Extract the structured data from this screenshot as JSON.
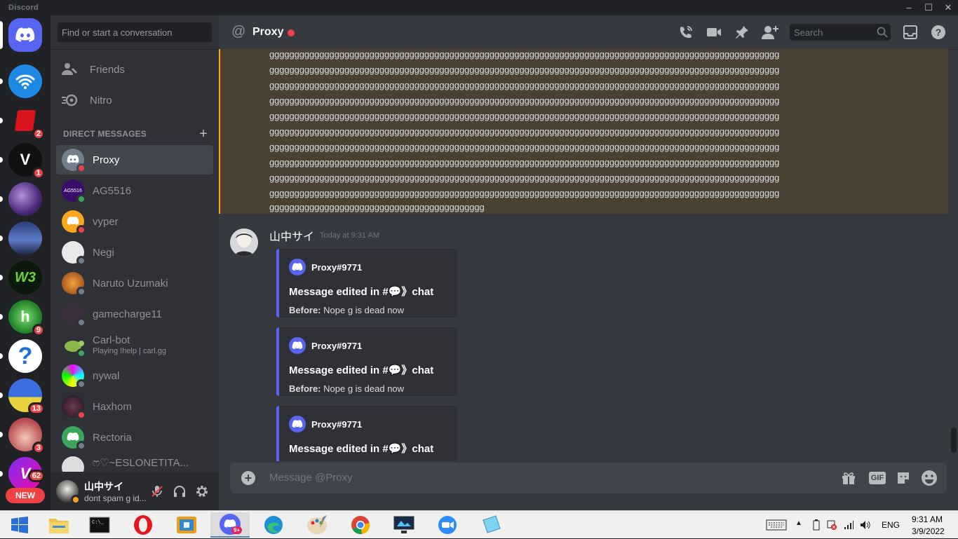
{
  "app": {
    "brand": "Discord"
  },
  "guilds": [
    {
      "name": "home",
      "badge": ""
    },
    {
      "name": "wifi-server",
      "badge": ""
    },
    {
      "name": "red-logo-server",
      "badge": "2"
    },
    {
      "name": "v-server",
      "letter": "V",
      "badge": "1"
    },
    {
      "name": "galaxy-server",
      "badge": ""
    },
    {
      "name": "night-town-server",
      "badge": ""
    },
    {
      "name": "w3-server",
      "badge": ""
    },
    {
      "name": "green-h-server",
      "badge": "9"
    },
    {
      "name": "question-server",
      "badge": ""
    },
    {
      "name": "blue-banner-server",
      "badge": "13"
    },
    {
      "name": "anime-girl-server",
      "badge": "3"
    },
    {
      "name": "v-purple-server",
      "badge": "62"
    }
  ],
  "guild_new_label": "NEW",
  "sidebar": {
    "search_placeholder": "Find or start a conversation",
    "friends_label": "Friends",
    "nitro_label": "Nitro",
    "dm_header": "DIRECT MESSAGES",
    "dms": [
      {
        "name": "Proxy",
        "status": "dnd",
        "selected": true
      },
      {
        "name": "AG5516",
        "status": "on"
      },
      {
        "name": "vyper",
        "status": "dnd"
      },
      {
        "name": "Negi",
        "status": "off"
      },
      {
        "name": "Naruto Uzumaki",
        "status": "off"
      },
      {
        "name": "gamecharge11",
        "status": "off"
      },
      {
        "name": "Carl-bot",
        "sub": "Playing !help | carl.gg",
        "status": "on"
      },
      {
        "name": "nywal",
        "status": "off"
      },
      {
        "name": "Haxhom",
        "status": "dnd"
      },
      {
        "name": "Rectoria",
        "status": "off"
      },
      {
        "name": "ෆ♡~ESLONETITA...",
        "status": "off"
      }
    ],
    "avatar_ag_text": "AG5516"
  },
  "user": {
    "name": "山中サイ",
    "status": "dont spam g id..."
  },
  "channel": {
    "at": "@",
    "name": "Proxy",
    "search_placeholder": "Search"
  },
  "spam_lines": [
    "gggggggggggggggggggggggggggggggggggggggggggggggggggggggggggggggggggggggggggggggggggggggggggggggggggggg",
    "gggggggggggggggggggggggggggggggggggggggggggggggggggggggggggggggggggggggggggggggggggggggggggggggggggggg",
    "gggggggggggggggggggggggggggggggggggggggggggggggggggggggggggggggggggggggggggggggggggggggggggggggggggggg",
    "gggggggggggggggggggggggggggggggggggggggggggggggggggggggggggggggggggggggggggggggggggggggggggggggggggggg",
    "gggggggggggggggggggggggggggggggggggggggggggggggggggggggggggggggggggggggggggggggggggggggggggggggggggggg",
    "gggggggggggggggggggggggggggggggggggggggggggggggggggggggggggggggggggggggggggggggggggggggggggggggggggggg",
    "gggggggggggggggggggggggggggggggggggggggggggggggggggggggggggggggggggggggggggggggggggggggggggggggggggggg",
    "gggggggggggggggggggggggggggggggggggggggggggggggggggggggggggggggggggggggggggggggggggggggggggggggggggggg",
    "gggggggggggggggggggggggggggggggggggggggggggggggggggggggggggggggggggggggggggggggggggggggggggggggggggggg",
    "gggggggggggggggggggggggggggggggggggggggggggggggggggggggggggggggggggggggggggggggggggggggggggggggggggggg",
    "ggggggggggggggggggggggggggggggggggggggggggg"
  ],
  "message": {
    "author": "山中サイ",
    "timestamp": "Today at 9:31 AM",
    "embeds": [
      {
        "author": "Proxy#9771",
        "title": "Message edited in #💬》chat",
        "before_label": "Before:",
        "before_text": "Nope g is dead now"
      },
      {
        "author": "Proxy#9771",
        "title": "Message edited in #💬》chat",
        "before_label": "Before:",
        "before_text": "Nope g is dead now"
      },
      {
        "author": "Proxy#9771",
        "title": "Message edited in #💬》chat",
        "before_label": "",
        "before_text": ""
      }
    ]
  },
  "composer": {
    "placeholder": "Message @Proxy",
    "gif_label": "GIF"
  },
  "taskbar": {
    "apps": [
      "start",
      "file-explorer",
      "terminal",
      "opera",
      "remote-app",
      "discord",
      "edge",
      "paint",
      "chrome",
      "monitor-app",
      "zoom",
      "notepad"
    ],
    "discord_badge": "9+",
    "lang": "ENG",
    "time": "9:31 AM",
    "date": "3/9/2022"
  }
}
